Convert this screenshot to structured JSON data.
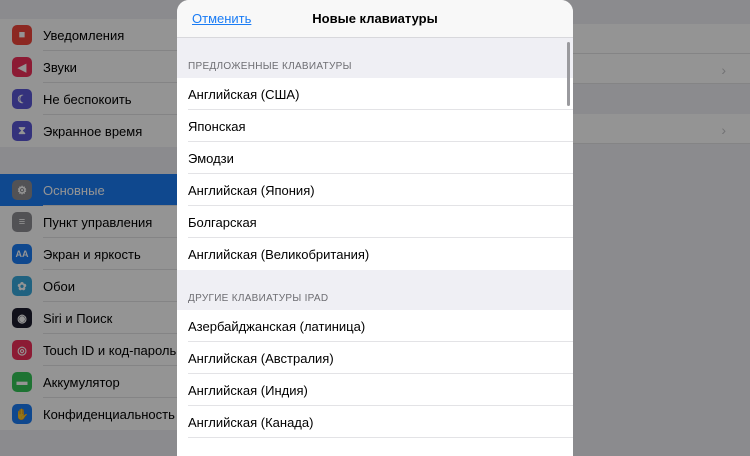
{
  "sidebar": {
    "group1": [
      {
        "label": "Уведомления",
        "icon": "notifications-icon",
        "color": "#f2463b"
      },
      {
        "label": "Звуки",
        "icon": "sounds-icon",
        "color": "#f2305a"
      },
      {
        "label": "Не беспокоить",
        "icon": "moon-icon",
        "color": "#5a56d6"
      },
      {
        "label": "Экранное время",
        "icon": "hourglass-icon",
        "color": "#5a56d6"
      }
    ],
    "group2": [
      {
        "label": "Основные",
        "icon": "gear-icon",
        "color": "#8e8e93",
        "selected": true
      },
      {
        "label": "Пункт управления",
        "icon": "toggles-icon",
        "color": "#8e8e93"
      },
      {
        "label": "Экран и яркость",
        "icon": "text-size-icon",
        "color": "#1a7cf5",
        "glyph": "AA"
      },
      {
        "label": "Обои",
        "icon": "flower-icon",
        "color": "#38aadc"
      },
      {
        "label": "Siri и Поиск",
        "icon": "siri-icon",
        "color": "#1c1c2e"
      },
      {
        "label": "Touch ID и код-пароль",
        "icon": "fingerprint-icon",
        "color": "#f2305a"
      },
      {
        "label": "Аккумулятор",
        "icon": "battery-icon",
        "color": "#35c759"
      },
      {
        "label": "Конфиденциальность",
        "icon": "hand-icon",
        "color": "#1a7cf5"
      }
    ]
  },
  "modal": {
    "cancel_label": "Отменить",
    "title": "Новые клавиатуры",
    "suggested_header": "ПРЕДЛОЖЕННЫЕ КЛАВИАТУРЫ",
    "suggested": [
      "Английская (США)",
      "Японская",
      "Эмодзи",
      "Английская (Япония)",
      "Болгарская",
      "Английская (Великобритания)"
    ],
    "other_header": "ДРУГИЕ КЛАВИАТУРЫ IPAD",
    "other": [
      "Азербайджанская (латиница)",
      "Английская (Австралия)",
      "Английская (Индия)",
      "Английская (Канада)"
    ]
  },
  "colors": {
    "accent": "#1a7cf5"
  }
}
